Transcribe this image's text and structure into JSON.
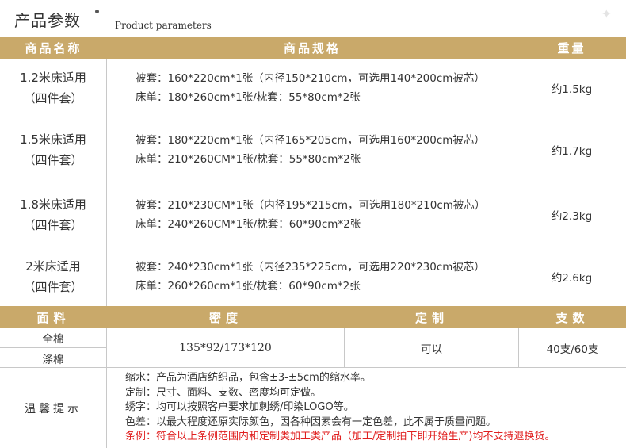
{
  "header": {
    "title": "产品参数",
    "subtitle": "Product parameters"
  },
  "product_table": {
    "columns": [
      "商品名称",
      "商品规格",
      "重量"
    ],
    "rows": [
      {
        "name_line1": "1.2米床适用",
        "name_line2": "（四件套）",
        "spec_line1": "被套：160*220cm*1张（内径150*210cm，可选用140*200cm被芯）",
        "spec_line2": "床单：180*260cm*1张/枕套：55*80cm*2张",
        "weight": "约1.5kg"
      },
      {
        "name_line1": "1.5米床适用",
        "name_line2": "（四件套）",
        "spec_line1": "被套：180*220cm*1张（内径165*205cm，可选用160*200cm被芯）",
        "spec_line2": "床单：210*260CM*1张/枕套：55*80cm*2张",
        "weight": "约1.7kg"
      },
      {
        "name_line1": "1.8米床适用",
        "name_line2": "（四件套）",
        "spec_line1": "被套：210*230CM*1张（内径195*215cm，可选用180*210cm被芯）",
        "spec_line2": "床单：240*260CM*1张/枕套：60*90cm*2张",
        "weight": "约2.3kg"
      },
      {
        "name_line1": "2米床适用",
        "name_line2": "（四件套）",
        "spec_line1": "被套：240*230cm*1张（内径235*225cm，可选用220*230cm被芯）",
        "spec_line2": "床单：260*260cm*1张/枕套：60*90cm*2张",
        "weight": "约2.6kg"
      }
    ]
  },
  "fabric_table": {
    "columns": [
      "面料",
      "密度",
      "定制",
      "支数"
    ],
    "fabrics": [
      "全棉",
      "涤棉"
    ],
    "density": "135*92/173*120",
    "custom": "可以",
    "count": "40支/60支"
  },
  "tips": {
    "label": "温馨提示",
    "lines": [
      "缩水：产品为酒店纺织品，包含±3-±5cm的缩水率。",
      "定制：尺寸、面料、支数、密度均可定做。",
      "绣字：均可以按照客户要求加刺绣/印染LOGO等。",
      "色差：以最大程度还原实际颜色，因各种因素会有一定色差，此不属于质量问题。"
    ],
    "warning": "条例：符合以上条例范围内和定制类加工类产品（加工/定制拍下即开始生产)均不支持退换货。"
  },
  "colors": {
    "header_bg": "#c9a96a",
    "warning": "#e02020"
  }
}
